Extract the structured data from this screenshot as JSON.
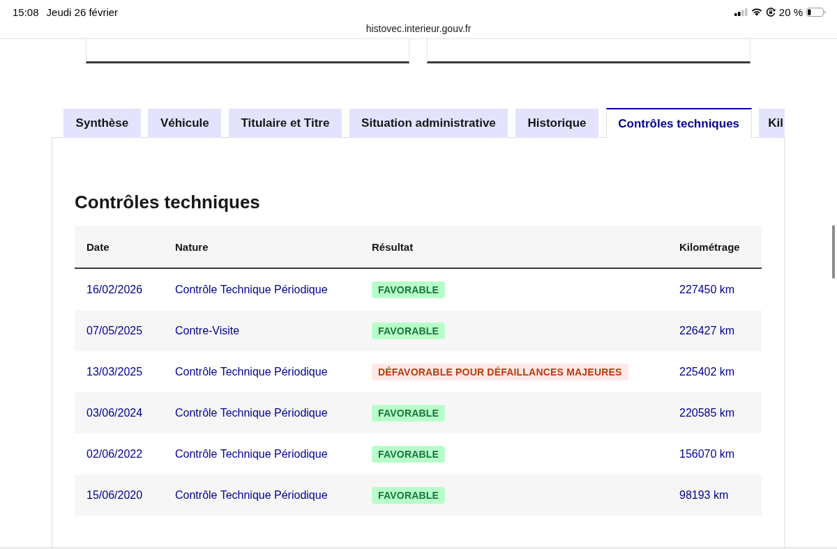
{
  "status_bar": {
    "time": "15:08",
    "date": "Jeudi 26 février",
    "battery": "20 %"
  },
  "address_bar": {
    "url": "histovec.interieur.gouv.fr"
  },
  "tabs": [
    {
      "label": "Synthèse",
      "selected": false
    },
    {
      "label": "Véhicule",
      "selected": false
    },
    {
      "label": "Titulaire et Titre",
      "selected": false
    },
    {
      "label": "Situation administrative",
      "selected": false
    },
    {
      "label": "Historique",
      "selected": false
    },
    {
      "label": "Contrôles techniques",
      "selected": true
    },
    {
      "label": "Kil",
      "selected": false
    }
  ],
  "panel": {
    "title": "Contrôles techniques",
    "table": {
      "columns": [
        "Date",
        "Nature",
        "Résultat",
        "Kilométrage"
      ],
      "rows": [
        {
          "date": "16/02/2026",
          "nature": "Contrôle Technique Périodique",
          "result": {
            "label": "FAVORABLE",
            "kind": "success"
          },
          "mileage": "227450 km"
        },
        {
          "date": "07/05/2025",
          "nature": "Contre-Visite",
          "result": {
            "label": "FAVORABLE",
            "kind": "success"
          },
          "mileage": "226427 km"
        },
        {
          "date": "13/03/2025",
          "nature": "Contrôle Technique Périodique",
          "result": {
            "label": "DÉFAVORABLE POUR DÉFAILLANCES MAJEURES",
            "kind": "error"
          },
          "mileage": "225402 km"
        },
        {
          "date": "03/06/2024",
          "nature": "Contrôle Technique Périodique",
          "result": {
            "label": "FAVORABLE",
            "kind": "success"
          },
          "mileage": "220585 km"
        },
        {
          "date": "02/06/2022",
          "nature": "Contrôle Technique Périodique",
          "result": {
            "label": "FAVORABLE",
            "kind": "success"
          },
          "mileage": "156070 km"
        },
        {
          "date": "15/06/2020",
          "nature": "Contrôle Technique Périodique",
          "result": {
            "label": "FAVORABLE",
            "kind": "success"
          },
          "mileage": "98193 km"
        }
      ]
    }
  }
}
